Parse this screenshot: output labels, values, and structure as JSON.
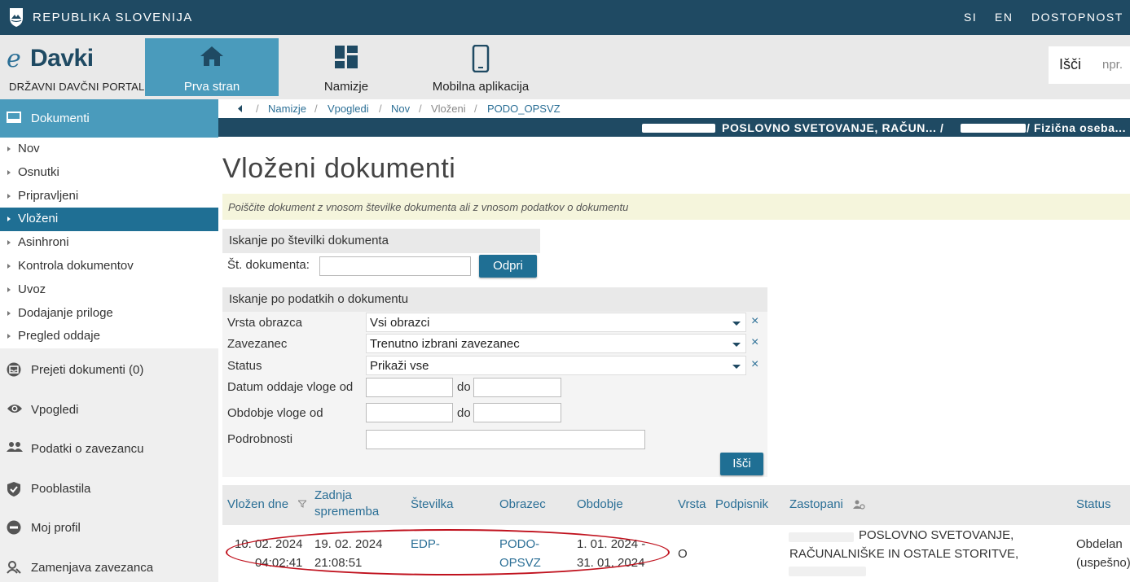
{
  "topbar": {
    "gov_name": "REPUBLIKA SLOVENIJA",
    "lang_si": "SI",
    "lang_en": "EN",
    "accessibility": "DOSTOPNOST"
  },
  "header": {
    "logo_e": "e",
    "logo_word": "Davki",
    "logo_sub": "DRŽAVNI DAVČNI PORTAL",
    "tabs": [
      {
        "label": "Prva stran",
        "icon": "home-icon"
      },
      {
        "label": "Namizje",
        "icon": "dashboard-icon"
      },
      {
        "label": "Mobilna aplikacija",
        "icon": "mobile-icon"
      }
    ],
    "search_label": "Išči",
    "search_placeholder": "npr."
  },
  "sidebar": {
    "header": "Dokumenti",
    "items": [
      "Nov",
      "Osnutki",
      "Pripravljeni",
      "Vloženi",
      "Asinhroni",
      "Kontrola dokumentov",
      "Uvoz",
      "Dodajanje priloge",
      "Pregled oddaje"
    ],
    "active_item": "Vloženi",
    "sections": [
      {
        "label": "Prejeti dokumenti (0)",
        "icon": "inbox-icon"
      },
      {
        "label": "Vpogledi",
        "icon": "eye-icon"
      },
      {
        "label": "Podatki o zavezancu",
        "icon": "people-icon"
      },
      {
        "label": "Pooblastila",
        "icon": "shield-icon"
      },
      {
        "label": "Moj profil",
        "icon": "minus-circle-icon"
      },
      {
        "label": "Zamenjava zavezanca",
        "icon": "swap-user-icon"
      }
    ]
  },
  "breadcrumb": {
    "items": [
      "Namizje",
      "Vpogledi",
      "Nov",
      "Vloženi",
      "PODO_OPSVZ"
    ],
    "separator": "/"
  },
  "context": {
    "text": "POSLOVNO SVETOVANJE, RAČUN... / ",
    "text2": "/ Fizična oseba..."
  },
  "page": {
    "title": "Vloženi dokumenti",
    "hint": "Poiščite dokument z vnosom številke dokumenta ali z vnosom podatkov o dokumentu"
  },
  "search_by_number": {
    "heading": "Iskanje po številki dokumenta",
    "label": "Št. dokumenta:",
    "value": "",
    "button": "Odpri"
  },
  "search_by_data": {
    "heading": "Iskanje po podatkih o dokumentu",
    "vrsta_label": "Vrsta obrazca",
    "vrsta_value": "Vsi obrazci",
    "zavezanec_label": "Zavezanec",
    "zavezanec_value": "Trenutno izbrani zavezanec",
    "status_label": "Status",
    "status_value": "Prikaži vse",
    "datum_label": "Datum oddaje vloge od",
    "obdobje_label": "Obdobje vloge od",
    "do_label": "do",
    "podrobnosti_label": "Podrobnosti",
    "clear_symbol": "×",
    "button": "Išči"
  },
  "table": {
    "columns": [
      "Vložen dne",
      "Zadnja sprememba",
      "Številka",
      "Obrazec",
      "Obdobje",
      "Vrsta",
      "Podpisnik",
      "Zastopani",
      "Status"
    ],
    "rows": [
      {
        "vlozen_date": "10. 02. 2024",
        "vlozen_time": "04:02:41",
        "spremeba_date": "19. 02. 2024",
        "spremeba_time": "21:08:51",
        "stevilka": "EDP-",
        "obrazec_1": "PODO-",
        "obrazec_2": "OPSVZ",
        "obdobje_1": "1. 01. 2024 -",
        "obdobje_2": "31. 01. 2024",
        "vrsta": "O",
        "podpisnik": "",
        "zastopani_1": "POSLOVNO SVETOVANJE,",
        "zastopani_2": "RAČUNALNIŠKE IN OSTALE STORITVE,",
        "status_1": "Obdelan",
        "status_2": "(uspešno)"
      }
    ]
  },
  "colors": {
    "topbar": "#1f4a63",
    "accent": "#4a9bbc",
    "active": "#1f6f94",
    "link": "#2b6f96",
    "highlight_oval": "#c0121e"
  }
}
